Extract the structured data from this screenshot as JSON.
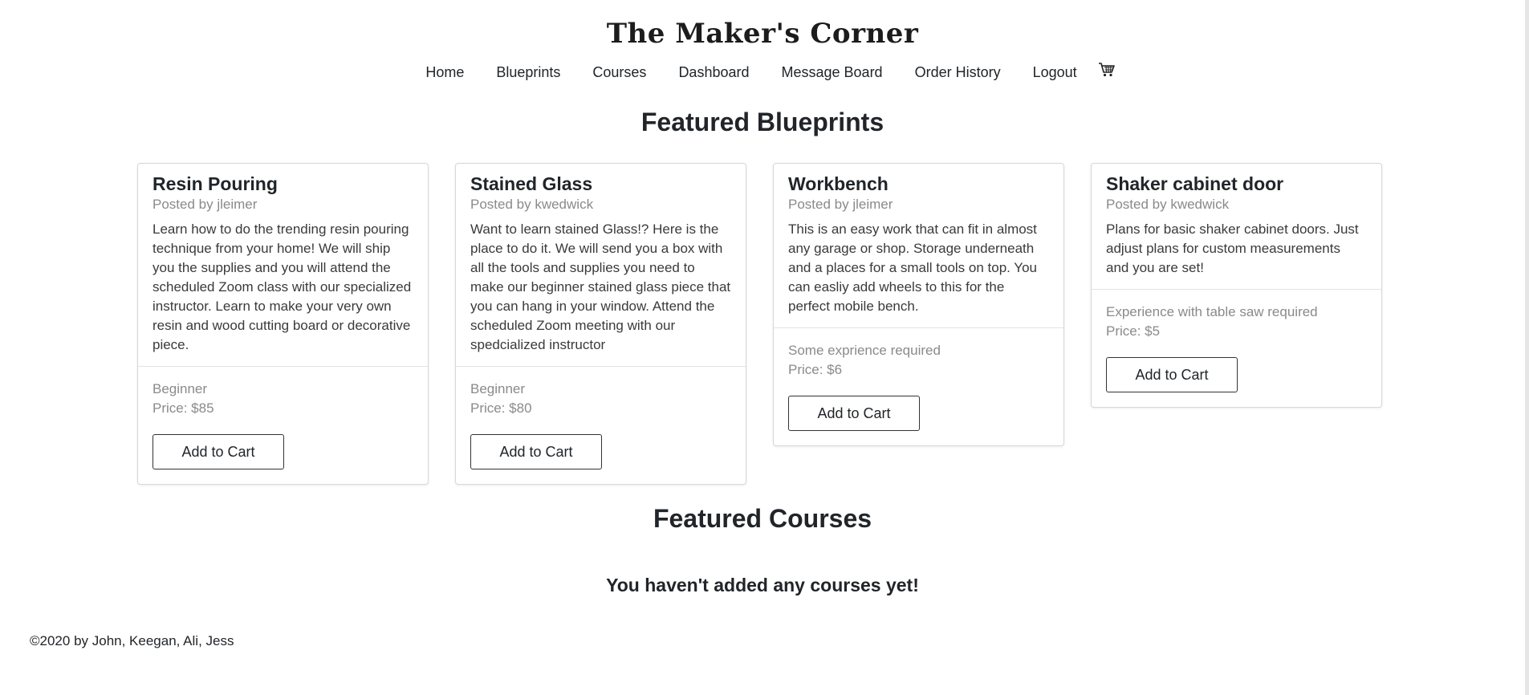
{
  "site": {
    "title": "The Maker's Corner"
  },
  "nav": {
    "items": [
      {
        "label": "Home"
      },
      {
        "label": "Blueprints"
      },
      {
        "label": "Courses"
      },
      {
        "label": "Dashboard"
      },
      {
        "label": "Message Board"
      },
      {
        "label": "Order History"
      },
      {
        "label": "Logout"
      }
    ],
    "cart_icon": "shopping-cart-icon"
  },
  "blueprints": {
    "heading": "Featured Blueprints",
    "cards": [
      {
        "title": "Resin Pouring",
        "author": "Posted by jleimer",
        "description": "Learn how to do the trending resin pouring technique from your home! We will ship you the supplies and you will attend the scheduled Zoom class with our specialized instructor. Learn to make your very own resin and wood cutting board or decorative piece.",
        "level": "Beginner",
        "price": "Price: $85",
        "button": "Add to Cart"
      },
      {
        "title": "Stained Glass",
        "author": "Posted by kwedwick",
        "description": "Want to learn stained Glass!? Here is the place to do it. We will send you a box with all the tools and supplies you need to make our beginner stained glass piece that you can hang in your window. Attend the scheduled Zoom meeting with our spedcialized instructor",
        "level": "Beginner",
        "price": "Price: $80",
        "button": "Add to Cart"
      },
      {
        "title": "Workbench",
        "author": "Posted by jleimer",
        "description": "This is an easy work that can fit in almost any garage or shop. Storage underneath and a places for a small tools on top. You can easliy add wheels to this for the perfect mobile bench.",
        "level": "Some exprience required",
        "price": "Price: $6",
        "button": "Add to Cart"
      },
      {
        "title": "Shaker cabinet door",
        "author": "Posted by kwedwick",
        "description": "Plans for basic shaker cabinet doors. Just adjust plans for custom measurements and you are set!",
        "level": "Experience with table saw required",
        "price": "Price: $5",
        "button": "Add to Cart"
      }
    ]
  },
  "courses": {
    "heading": "Featured Courses",
    "empty_message": "You haven't added any courses yet!"
  },
  "footer": {
    "copyright": "©2020 by John, Keegan, Ali, Jess"
  }
}
